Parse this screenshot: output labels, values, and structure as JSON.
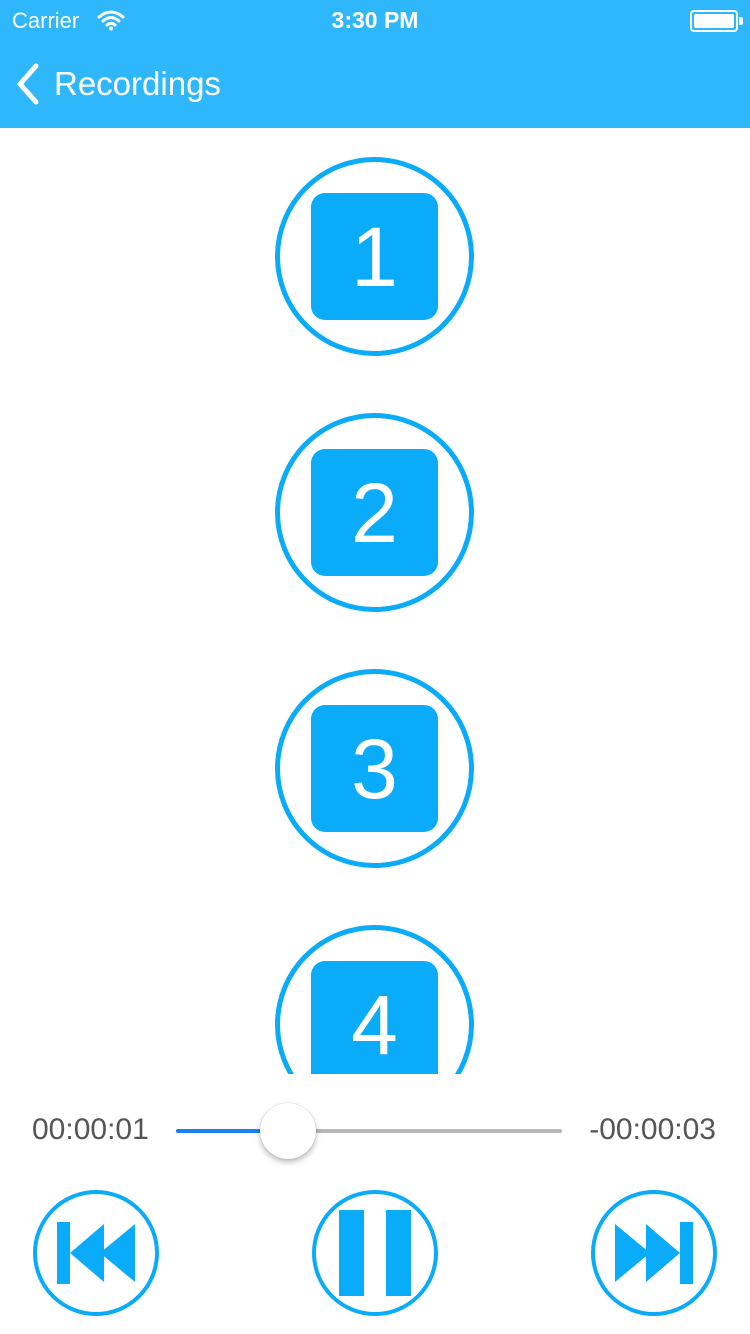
{
  "status_bar": {
    "carrier": "Carrier",
    "time": "3:30 PM",
    "icons": [
      "wifi-icon",
      "battery-icon"
    ]
  },
  "nav": {
    "back_label": "Recordings",
    "back_icon": "chevron-left-icon"
  },
  "recordings": [
    {
      "label": "1"
    },
    {
      "label": "2"
    },
    {
      "label": "3"
    },
    {
      "label": "4"
    }
  ],
  "player": {
    "elapsed": "00:00:01",
    "remaining": "-00:00:03",
    "progress": 0.29,
    "controls": [
      "rewind-icon",
      "pause-icon",
      "fast-forward-icon"
    ]
  },
  "colors": {
    "accent": "#0aabf8",
    "header": "#2eb8fb",
    "slider_fill": "#1c7ef2",
    "slider_track": "#b8b8b8",
    "time_text": "#555555"
  }
}
